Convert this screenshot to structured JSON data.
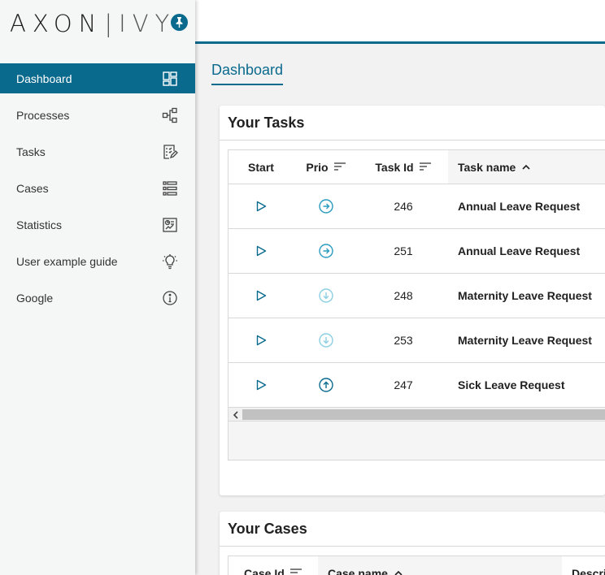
{
  "app": {
    "logo_main": "AXON",
    "logo_sub": "IVY"
  },
  "sidebar": {
    "items": [
      {
        "label": "Dashboard",
        "icon": "dashboard-icon",
        "active": true
      },
      {
        "label": "Processes",
        "icon": "process-icon"
      },
      {
        "label": "Tasks",
        "icon": "tasks-icon"
      },
      {
        "label": "Cases",
        "icon": "cases-icon"
      },
      {
        "label": "Statistics",
        "icon": "statistics-icon"
      },
      {
        "label": "User example guide",
        "icon": "lightbulb-icon"
      },
      {
        "label": "Google",
        "icon": "info-icon"
      }
    ]
  },
  "breadcrumb": {
    "label": "Dashboard"
  },
  "tasks_widget": {
    "title": "Your Tasks",
    "columns": {
      "start": "Start",
      "prio": "Prio",
      "task_id": "Task Id",
      "task_name": "Task name"
    },
    "rows": [
      {
        "id": "246",
        "name": "Annual Leave Request",
        "prio": "normal"
      },
      {
        "id": "251",
        "name": "Annual Leave Request",
        "prio": "normal"
      },
      {
        "id": "248",
        "name": "Maternity Leave Request",
        "prio": "low"
      },
      {
        "id": "253",
        "name": "Maternity Leave Request",
        "prio": "low"
      },
      {
        "id": "247",
        "name": "Sick Leave Request",
        "prio": "high"
      }
    ]
  },
  "cases_widget": {
    "title": "Your Cases",
    "columns": {
      "case_id": "Case Id",
      "case_name": "Case name",
      "description": "Descri"
    }
  },
  "colors": {
    "accent": "#0a6a8e",
    "prio_normal": "#2a9bbf",
    "prio_low": "#8ccfe3",
    "prio_high": "#0a6a8e"
  }
}
